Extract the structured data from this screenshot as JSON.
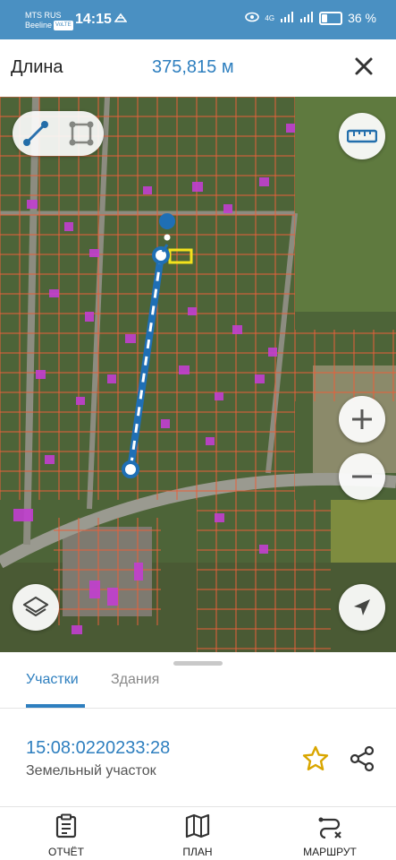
{
  "status_bar": {
    "carrier1": "MTS RUS",
    "carrier2": "Beeline",
    "volte": "VoLTE",
    "time": "14:15",
    "network": "4G",
    "battery": "36 %",
    "battery_level": 0.36
  },
  "header": {
    "title": "Длина",
    "value": "375,815 м"
  },
  "map_controls": {
    "line_tool_icon": "line-measure-icon",
    "area_tool_icon": "area-measure-icon",
    "ruler_icon": "ruler-icon",
    "zoom_in": "+",
    "zoom_out": "−",
    "layers_icon": "layers-icon",
    "locate_icon": "navigation-arrow-icon"
  },
  "tabs": [
    {
      "label": "Участки"
    },
    {
      "label": "Здания"
    }
  ],
  "parcel": {
    "id": "15:08:0220233:28",
    "type": "Земельный участок"
  },
  "bottom_nav": [
    {
      "label": "ОТЧЁТ",
      "icon": "report-icon"
    },
    {
      "label": "ПЛАН",
      "icon": "map-plan-icon"
    },
    {
      "label": "МАРШРУТ",
      "icon": "route-icon"
    }
  ],
  "colors": {
    "accent": "#2e7fbf",
    "status_bar": "#4a90c2",
    "parcel_border": "#e8603a",
    "building": "#c23fd0",
    "selected_parcel": "#f3e21c",
    "measure_line": "#1f6fb5",
    "star": "#d9a600"
  }
}
